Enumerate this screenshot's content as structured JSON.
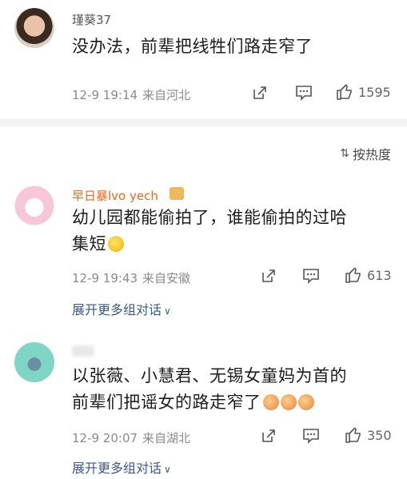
{
  "comments": [
    {
      "username": "瑾葵37",
      "text": "没办法，前辈把线牲们路走窄了",
      "date": "12-9 19:14",
      "location": "来自河北",
      "likes": "1595"
    },
    {
      "username": "早日暴lvo yech",
      "text_line1": "幼儿园都能偷拍了，谁能偷拍的过哈",
      "text_line2": "集短",
      "date": "12-9 19:43",
      "location": "来自安徽",
      "likes": "613",
      "expand": "展开更多组对话"
    },
    {
      "username": "",
      "text_line1": "以张薇、小慧君、无锡女童妈为首的",
      "text_line2": "前辈们把谣女的路走窄了",
      "date": "12-9 20:07",
      "location": "来自湖北",
      "likes": "350",
      "expand": "展开更多组对话"
    }
  ],
  "sort_label": "按热度",
  "colors": {
    "username_orange": "#e86a1b",
    "link_blue": "#3a5a88",
    "meta_gray": "#8a8a8a"
  }
}
